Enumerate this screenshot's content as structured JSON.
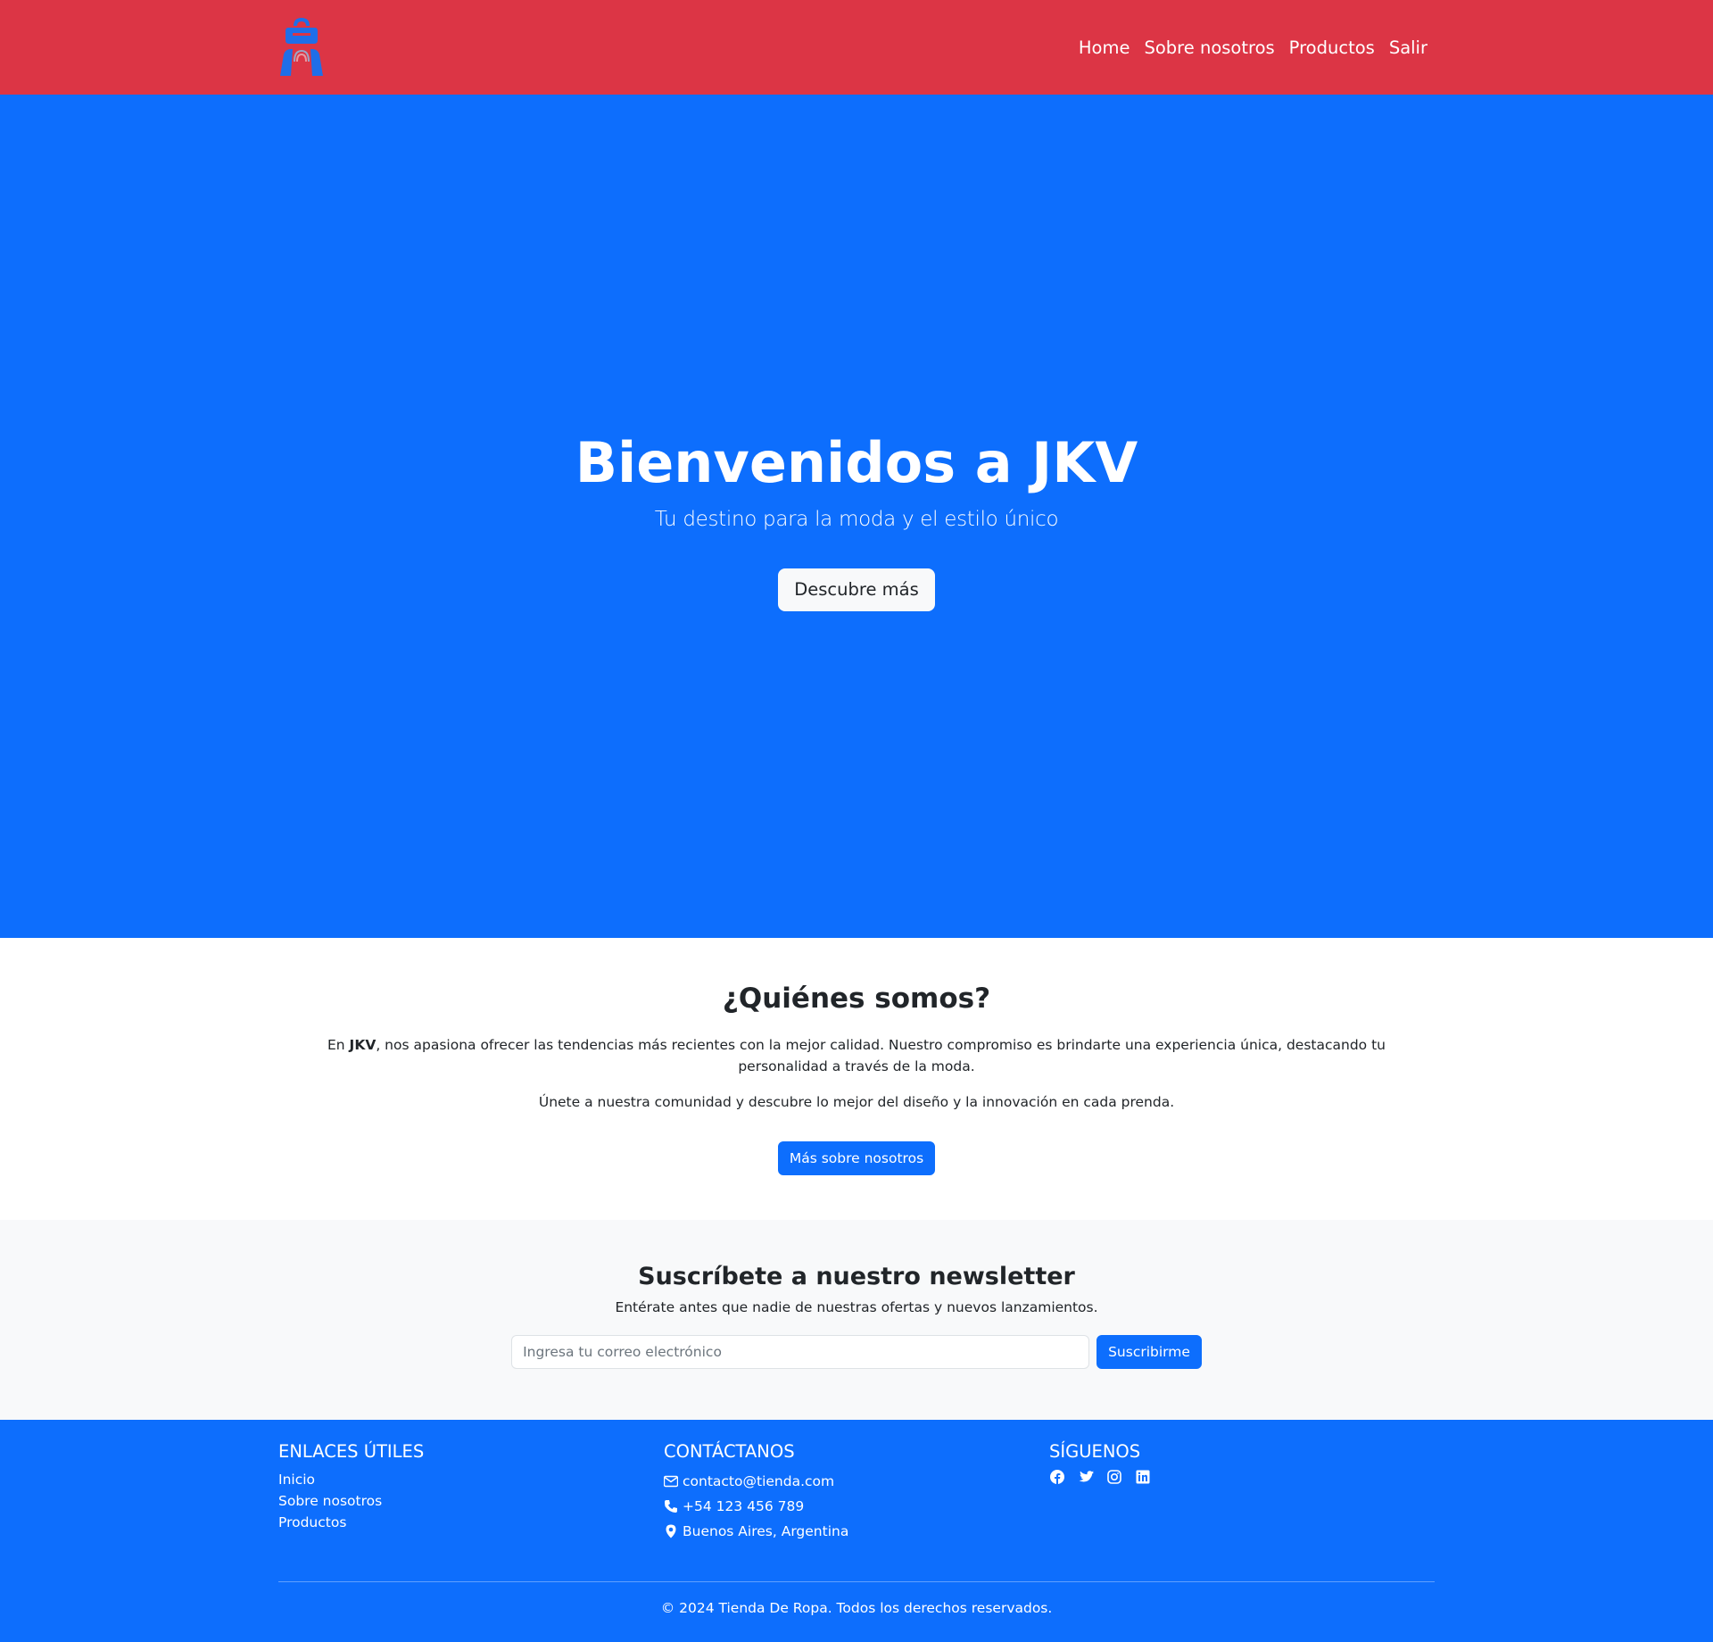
{
  "colors": {
    "navbar_bg": "#dc3545",
    "primary": "#0d6efd",
    "light": "#f8f9fa",
    "text": "#212529"
  },
  "navbar": {
    "logo_icon": "shopping-bag-logo",
    "links": [
      "Home",
      "Sobre nosotros",
      "Productos",
      "Salir"
    ]
  },
  "hero": {
    "title": "Bienvenidos a JKV",
    "subtitle": "Tu destino para la moda y el estilo único",
    "button": "Descubre más"
  },
  "about": {
    "title": "¿Quiénes somos?",
    "text_prefix": "En ",
    "brand": "JKV",
    "text_suffix": ", nos apasiona ofrecer las tendencias más recientes con la mejor calidad. Nuestro compromiso es brindarte una experiencia única, destacando tu personalidad a través de la moda.",
    "text2": "Únete a nuestra comunidad y descubre lo mejor del diseño y la innovación en cada prenda.",
    "button": "Más sobre nosotros"
  },
  "newsletter": {
    "title": "Suscríbete a nuestro newsletter",
    "subtitle": "Entérate antes que nadie de nuestras ofertas y nuevos lanzamientos.",
    "input_placeholder": "Ingresa tu correo electrónico",
    "button": "Suscribirme"
  },
  "footer": {
    "links_heading": "ENLACES ÚTILES",
    "links": [
      "Inicio",
      "Sobre nosotros",
      "Productos"
    ],
    "contact_heading": "CONTÁCTANOS",
    "contact": {
      "email": "contacto@tienda.com",
      "phone": "+54 123 456 789",
      "location": "Buenos Aires, Argentina"
    },
    "social_heading": "SÍGUENOS",
    "social_icons": [
      "facebook-icon",
      "twitter-icon",
      "instagram-icon",
      "linkedin-icon"
    ],
    "copyright": "© 2024 Tienda De Ropa. Todos los derechos reservados."
  }
}
